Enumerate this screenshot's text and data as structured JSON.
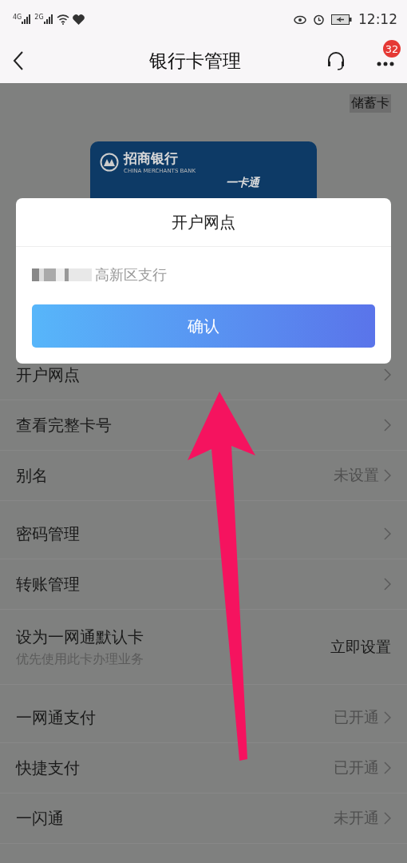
{
  "status_bar": {
    "networks": [
      "4G",
      "2G"
    ],
    "time": "12:12"
  },
  "nav": {
    "title": "银行卡管理",
    "badge": "32"
  },
  "card_type": "储蓄卡",
  "card": {
    "bank_name": "招商银行",
    "bank_name_en": "CHINA MERCHANTS BANK",
    "product": "一卡通"
  },
  "dialog": {
    "title": "开户网点",
    "value": "高新区支行",
    "button": "确认"
  },
  "groups": [
    [
      {
        "label": "开户网点",
        "chevron": true
      },
      {
        "label": "查看完整卡号",
        "chevron": true
      },
      {
        "label": "别名",
        "value": "未设置",
        "chevron": true
      }
    ],
    [
      {
        "label": "密码管理",
        "chevron": true
      },
      {
        "label": "转账管理",
        "chevron": true
      },
      {
        "label": "设为一网通默认卡",
        "sublabel": "优先使用此卡办理业务",
        "value": "立即设置",
        "chevron": false
      }
    ],
    [
      {
        "label": "一网通支付",
        "value": "已开通",
        "chevron": true
      },
      {
        "label": "快捷支付",
        "value": "已开通",
        "chevron": true
      },
      {
        "label": "一闪通",
        "value": "未开通",
        "chevron": true
      }
    ]
  ]
}
